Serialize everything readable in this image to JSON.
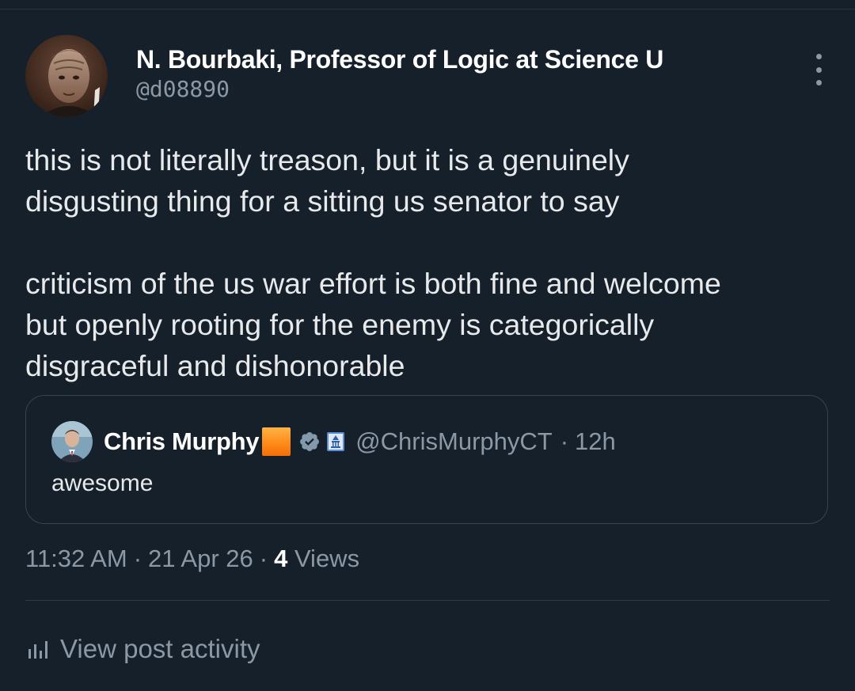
{
  "post": {
    "author": {
      "display_name": "N. Bourbaki, Professor of Logic at Science U",
      "handle": "@d08890"
    },
    "text_paragraphs": [
      [
        "this is not literally treason, but it is a genuinely",
        "disgusting thing for a sitting us senator to say"
      ],
      [
        "criticism of the us war effort is both fine and welcome",
        "but openly rooting for the enemy is categorically",
        "disgraceful and dishonorable"
      ]
    ],
    "quoted": {
      "display_name": "Chris Murphy",
      "handle": "@ChrisMurphyCT",
      "separator": "·",
      "time": "12h",
      "text": "awesome"
    },
    "meta": {
      "time": "11:32 AM",
      "date": "21 Apr 26",
      "separator": "·",
      "views_count": "4",
      "views_label": "Views"
    },
    "activity_label": "View post activity"
  },
  "colors": {
    "background": "#15202b",
    "primary_text": "#e7e9ea",
    "secondary_text": "#8b98a5",
    "border": "#38444d",
    "verified": "#829aab"
  },
  "icons": {
    "more": "more-vertical-icon",
    "verified": "verified-badge-icon",
    "government": "government-building-icon",
    "activity": "bar-chart-icon"
  }
}
